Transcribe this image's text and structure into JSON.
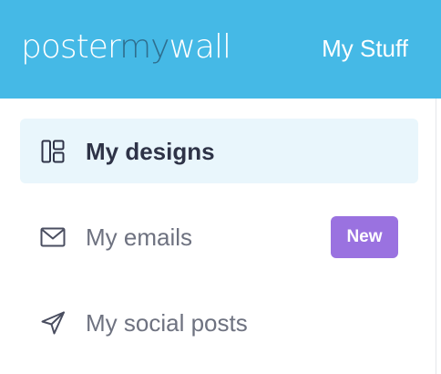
{
  "header": {
    "logo": {
      "part1": "poster",
      "part2": "my",
      "part3": "wall"
    },
    "my_stuff_label": "My Stuff",
    "background_color": "#45b9e6",
    "logo_accent_color": "#2f6e8e"
  },
  "menu": {
    "items": [
      {
        "label": "My designs",
        "icon": "layout-icon",
        "active": true
      },
      {
        "label": "My emails",
        "icon": "envelope-icon",
        "badge": "New",
        "badge_color": "#9a72e0"
      },
      {
        "label": "My social posts",
        "icon": "send-icon"
      }
    ],
    "active_background": "#e9f6fc"
  }
}
